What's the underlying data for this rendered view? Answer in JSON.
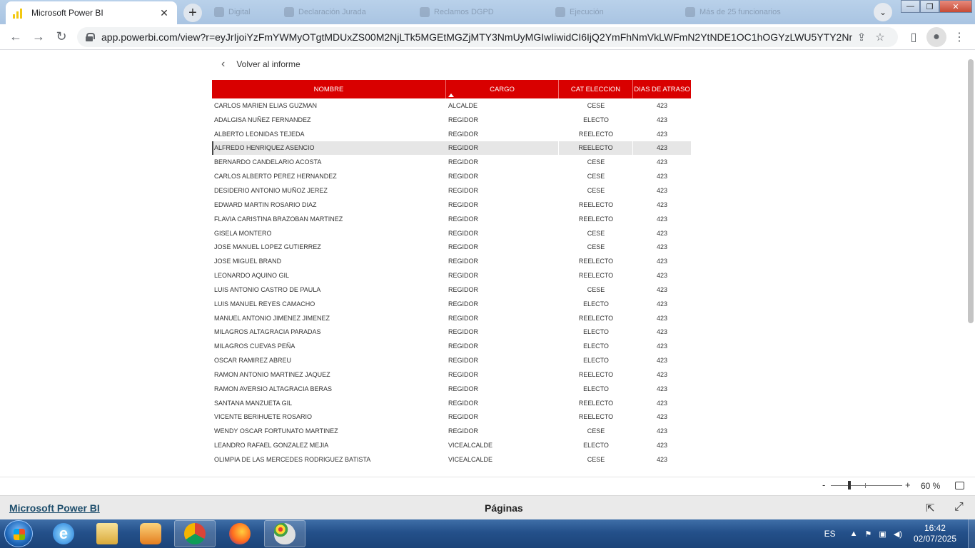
{
  "browser": {
    "active_tab_title": "Microsoft Power BI",
    "background_tabs": [
      "Digital",
      "Declaración Jurada",
      "Reclamos DGPD",
      "Ejecución",
      "Más de 25 funcionarios"
    ],
    "url": "app.powerbi.com/view?r=eyJrIjoiYzFmYWMyOTgtMDUxZS00M2NjLTk5MGEtMGZjMTY3NmUyMGIwIiwidCI6IjQ2YmFhNmVkLWFmN2YtNDE1OC1hOGYzLWU5YTY2NmFi..."
  },
  "report": {
    "back_label": "Volver al informe",
    "columns": [
      "NOMBRE",
      "CARGO",
      "CAT ELECCION",
      "DIAS DE ATRASO"
    ],
    "selected_row_index": 3,
    "rows": [
      [
        "CARLOS MARIEN ELIAS GUZMAN",
        "ALCALDE",
        "CESE",
        "423"
      ],
      [
        "ADALGISA NUÑEZ FERNANDEZ",
        "REGIDOR",
        "ELECTO",
        "423"
      ],
      [
        "ALBERTO LEONIDAS TEJEDA",
        "REGIDOR",
        "REELECTO",
        "423"
      ],
      [
        "ALFREDO HENRIQUEZ ASENCIO",
        "REGIDOR",
        "REELECTO",
        "423"
      ],
      [
        "BERNARDO CANDELARIO ACOSTA",
        "REGIDOR",
        "CESE",
        "423"
      ],
      [
        "CARLOS ALBERTO PEREZ HERNANDEZ",
        "REGIDOR",
        "CESE",
        "423"
      ],
      [
        "DESIDERIO ANTONIO MUÑOZ JEREZ",
        "REGIDOR",
        "CESE",
        "423"
      ],
      [
        "EDWARD MARTIN ROSARIO DIAZ",
        "REGIDOR",
        "REELECTO",
        "423"
      ],
      [
        "FLAVIA CARISTINA BRAZOBAN MARTINEZ",
        "REGIDOR",
        "REELECTO",
        "423"
      ],
      [
        "GISELA MONTERO",
        "REGIDOR",
        "CESE",
        "423"
      ],
      [
        "JOSE MANUEL LOPEZ GUTIERREZ",
        "REGIDOR",
        "CESE",
        "423"
      ],
      [
        "JOSE MIGUEL BRAND",
        "REGIDOR",
        "REELECTO",
        "423"
      ],
      [
        "LEONARDO AQUINO GIL",
        "REGIDOR",
        "REELECTO",
        "423"
      ],
      [
        "LUIS ANTONIO CASTRO DE PAULA",
        "REGIDOR",
        "CESE",
        "423"
      ],
      [
        "LUIS MANUEL REYES CAMACHO",
        "REGIDOR",
        "ELECTO",
        "423"
      ],
      [
        "MANUEL ANTONIO JIMENEZ JIMENEZ",
        "REGIDOR",
        "REELECTO",
        "423"
      ],
      [
        "MILAGROS ALTAGRACIA PARADAS",
        "REGIDOR",
        "ELECTO",
        "423"
      ],
      [
        "MILAGROS CUEVAS PEÑA",
        "REGIDOR",
        "ELECTO",
        "423"
      ],
      [
        "OSCAR RAMIREZ ABREU",
        "REGIDOR",
        "ELECTO",
        "423"
      ],
      [
        "RAMON ANTONIO MARTINEZ JAQUEZ",
        "REGIDOR",
        "REELECTO",
        "423"
      ],
      [
        "RAMON AVERSIO ALTAGRACIA BERAS",
        "REGIDOR",
        "ELECTO",
        "423"
      ],
      [
        "SANTANA MANZUETA GIL",
        "REGIDOR",
        "REELECTO",
        "423"
      ],
      [
        "VICENTE BERIHUETE ROSARIO",
        "REGIDOR",
        "REELECTO",
        "423"
      ],
      [
        "WENDY OSCAR FORTUNATO MARTINEZ",
        "REGIDOR",
        "CESE",
        "423"
      ],
      [
        "LEANDRO RAFAEL GONZALEZ MEJIA",
        "VICEALCALDE",
        "ELECTO",
        "423"
      ],
      [
        "OLIMPIA DE LAS MERCEDES RODRIGUEZ BATISTA",
        "VICEALCALDE",
        "CESE",
        "423"
      ]
    ],
    "header_color": "#d90000"
  },
  "zoom": {
    "minus": "-",
    "plus": "+",
    "value_label": "60 %",
    "level_fraction": 0.26
  },
  "footer": {
    "brand": "Microsoft Power BI",
    "pages_label": "Páginas"
  },
  "taskbar": {
    "language": "ES",
    "time": "16:42",
    "date": "02/07/2025",
    "apps": [
      "internet-explorer-icon",
      "file-explorer-icon",
      "media-player-icon",
      "chrome-icon",
      "firefox-icon",
      "paint-icon"
    ]
  }
}
